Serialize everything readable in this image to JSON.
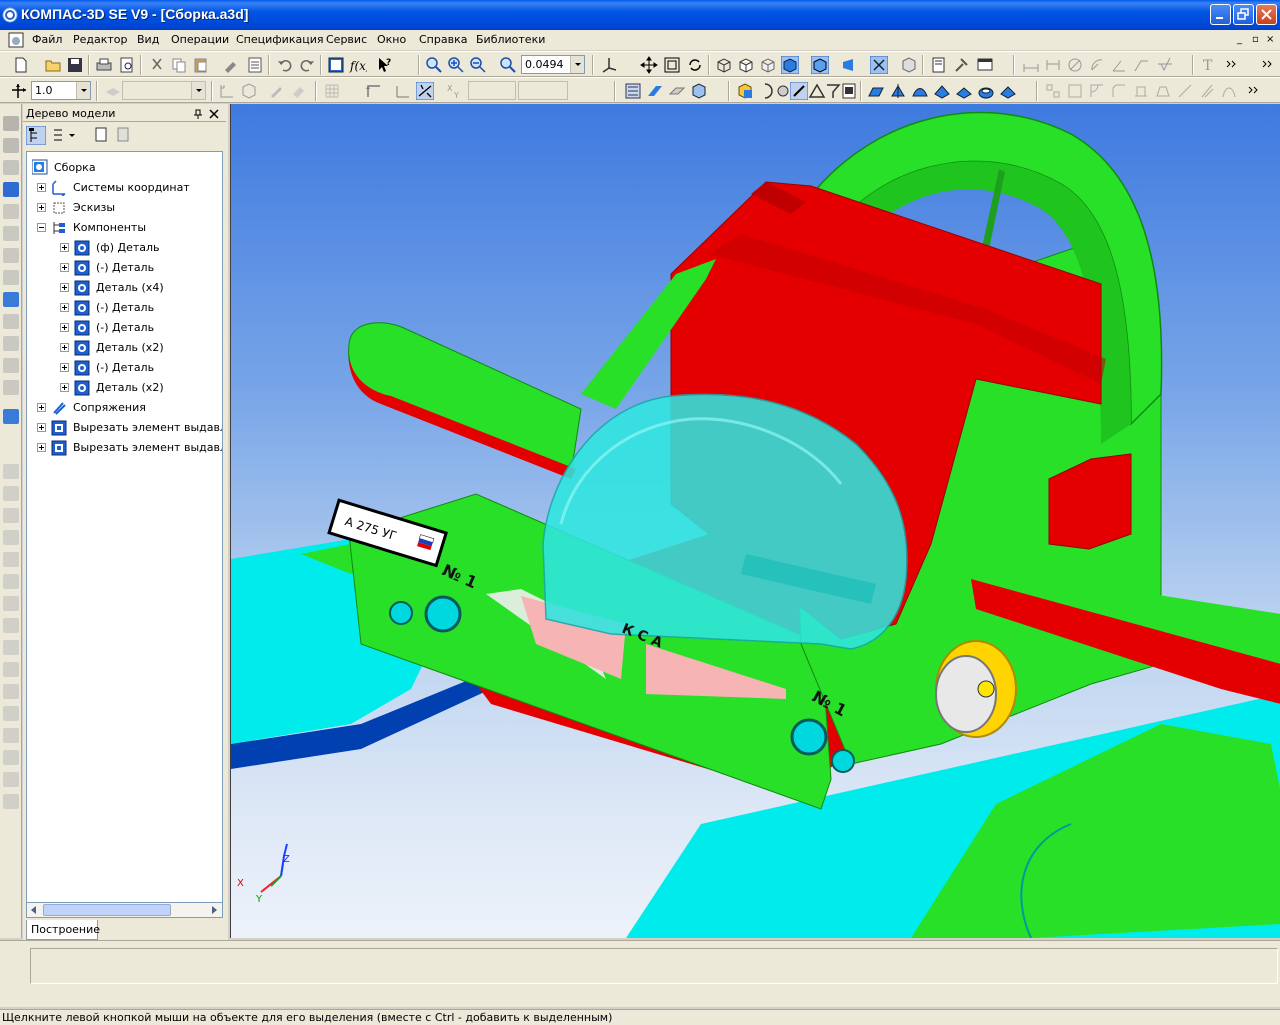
{
  "window": {
    "title": "КОМПАС-3D SE V9 - [Сборка.a3d]"
  },
  "menu": {
    "items": [
      "Файл",
      "Редактор",
      "Вид",
      "Операции",
      "Спецификация",
      "Сервис",
      "Окно",
      "Справка",
      "Библиотеки"
    ],
    "mdi_controls": [
      "_",
      "▫",
      "×"
    ]
  },
  "toolbar": {
    "zoom_value": "0.0494",
    "step_value": "1.0"
  },
  "tree": {
    "header": "Дерево модели",
    "root": "Сборка",
    "nodes": [
      {
        "label": "Системы координат",
        "depth": 1,
        "expand": "plus"
      },
      {
        "label": "Эскизы",
        "depth": 1,
        "expand": "plus"
      },
      {
        "label": "Компоненты",
        "depth": 1,
        "expand": "minus"
      },
      {
        "label": "(ф) Деталь",
        "depth": 2,
        "expand": "plus"
      },
      {
        "label": "(-) Деталь",
        "depth": 2,
        "expand": "plus"
      },
      {
        "label": "Деталь (x4)",
        "depth": 2,
        "expand": "plus"
      },
      {
        "label": "(-) Деталь",
        "depth": 2,
        "expand": "plus"
      },
      {
        "label": "(-) Деталь",
        "depth": 2,
        "expand": "plus"
      },
      {
        "label": "Деталь (x2)",
        "depth": 2,
        "expand": "plus"
      },
      {
        "label": "(-) Деталь",
        "depth": 2,
        "expand": "plus"
      },
      {
        "label": "Деталь (x2)",
        "depth": 2,
        "expand": "plus"
      },
      {
        "label": "Сопряжения",
        "depth": 1,
        "expand": "plus"
      },
      {
        "label": "Вырезать элемент выдавли",
        "depth": 1,
        "expand": "plus"
      },
      {
        "label": "Вырезать элемент выдавли",
        "depth": 1,
        "expand": "plus"
      }
    ],
    "tab": "Построение"
  },
  "model": {
    "plate_text": "А 275 УГ",
    "label_number_1": "№ 1",
    "label_kca": "К С А",
    "label_number_2": "№ 1",
    "axis_x": "X",
    "axis_y": "Y",
    "axis_z": "Z"
  },
  "status": {
    "hint": "Щелкните левой кнопкой мыши на объекте для его выделения (вместе с Ctrl - добавить к выделенным)"
  }
}
